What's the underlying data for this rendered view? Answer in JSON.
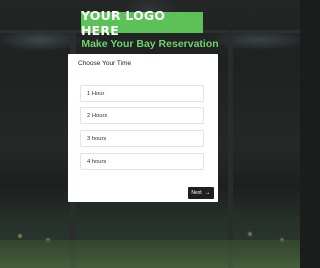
{
  "logo": {
    "text": "YOUR LOGO HERE"
  },
  "headline": "Make Your Bay Reservation",
  "form": {
    "title": "Choose Your Time",
    "options": [
      {
        "label": "1 Hour"
      },
      {
        "label": "2 Hours"
      },
      {
        "label": "3 hours"
      },
      {
        "label": "4 hours"
      }
    ],
    "next_label": "Next",
    "next_icon": "arrow-right-icon"
  },
  "colors": {
    "logo_bg": "#5cc157",
    "headline": "#6fd36a",
    "card_bg": "#ffffff",
    "button_bg": "#1f1f1f"
  }
}
